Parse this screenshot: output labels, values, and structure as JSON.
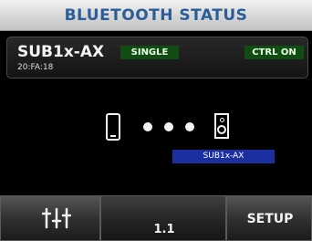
{
  "header": {
    "title": "BLUETOOTH STATUS"
  },
  "device": {
    "name": "SUB1x-AX",
    "mac": "20:FA:18",
    "mode_badge": "SINGLE",
    "control_badge": "CTRL ON"
  },
  "connection": {
    "source_icon": "smartphone-icon",
    "link_icon": "connection-dots",
    "target_icon": "speaker-icon",
    "target_label": "SUB1x-AX"
  },
  "footer": {
    "mixer_icon": "mixer-sliders-icon",
    "scene_value": "1.1",
    "setup_label": "SETUP"
  },
  "colors": {
    "title_text": "#2a5e98",
    "badge_bg": "#114d13",
    "label_bg": "#1b2fa0",
    "background": "#000000"
  }
}
